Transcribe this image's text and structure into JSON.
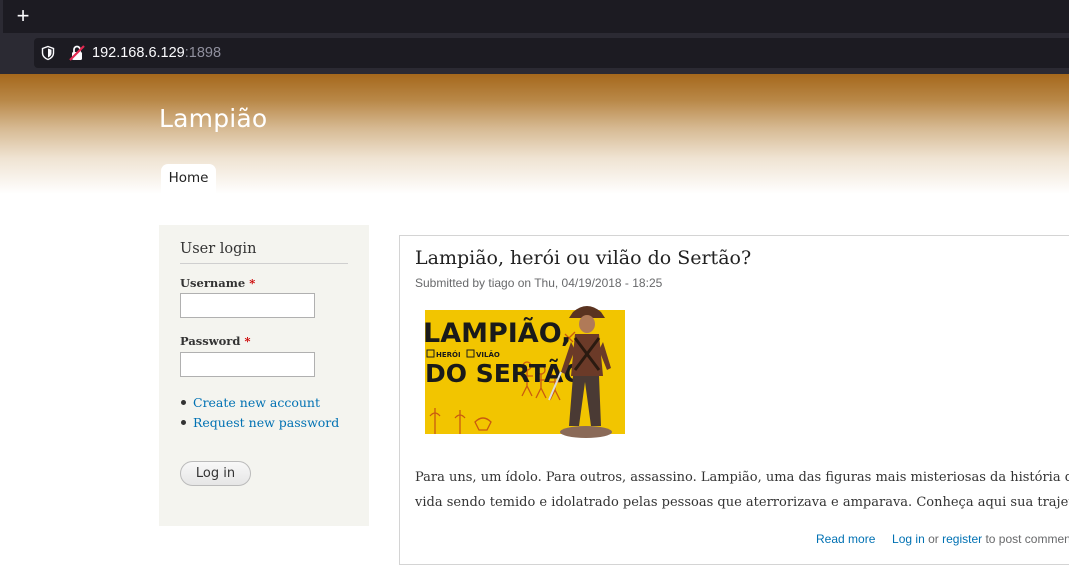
{
  "browser": {
    "newtab_icon": "+",
    "url_host": "192.168.6.129",
    "url_port": ":1898"
  },
  "site": {
    "name": "Lampião",
    "nav": {
      "home": "Home"
    }
  },
  "login": {
    "title": "User login",
    "username_label": "Username",
    "password_label": "Password",
    "required_mark": "*",
    "username_value": "",
    "password_value": "",
    "links": [
      "Create new account",
      "Request new password"
    ],
    "button": "Log in"
  },
  "article": {
    "title": "Lampião, herói ou vilão do Sertão?",
    "submitted": "Submitted by tiago on Thu, 04/19/2018 - 18:25",
    "image": {
      "line1": "LAMPIÃO,",
      "check1": "HERÓI",
      "check2": "VILÃO",
      "line2": "DO SERTÃO"
    },
    "body_line1": "Para uns, um ídolo. Para outros, assassino. Lampião, uma das figuras mais misteriosas da história do Brasil, passou a",
    "body_line2": "vida sendo temido e idolatrado pelas pessoas que aterrorizava e amparava. Conheça aqui sua trajetória.",
    "read_more": "Read more",
    "login_link": "Log in",
    "or": " or ",
    "register_link": "register",
    "post_comments": " to post comments"
  },
  "colors": {
    "link": "#0071b3",
    "header_top": "#a5681c",
    "sidebar_bg": "#f4f4ef",
    "image_yellow": "#f2c500"
  }
}
